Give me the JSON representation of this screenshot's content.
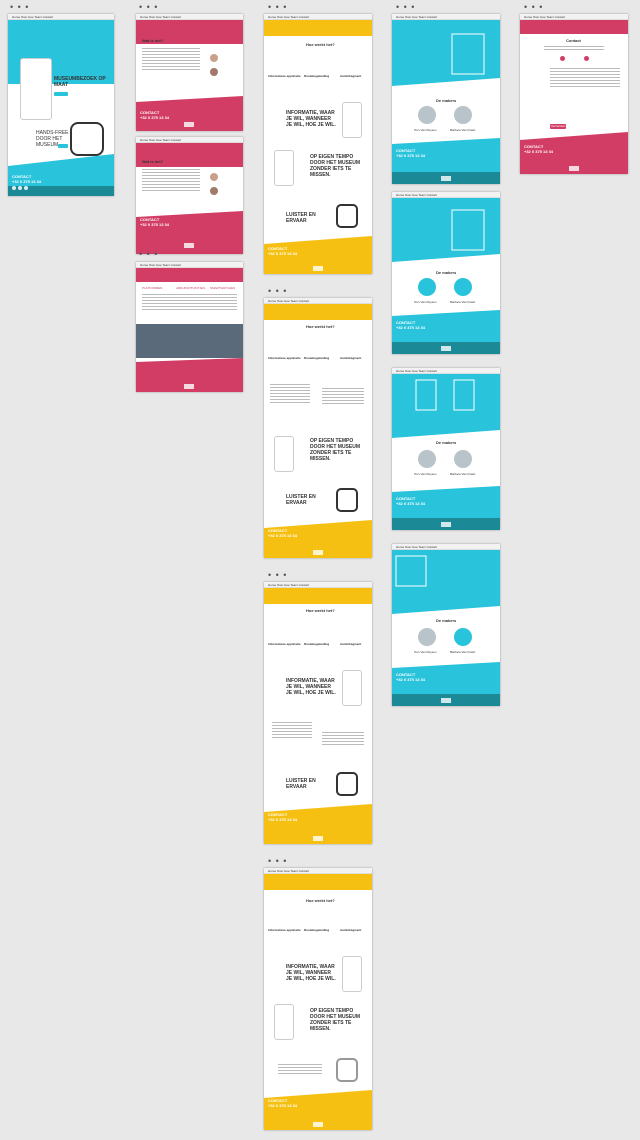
{
  "colors": {
    "cyan": "#29c4dc",
    "teal": "#1c8a96",
    "crimson": "#d23d66",
    "yellow": "#f6c012",
    "gray": "#e8e8e8"
  },
  "dots": "• • •",
  "nav": "Home  Over  Hoe  Team  Contact",
  "col1": {
    "hero_title": "MUSEUMBEZOEK OP MAAT",
    "hero_sub": "HANDS-FREE DOOR HET MUSEUM",
    "contact_label": "CONTACT",
    "contact_phone": "+32 0 375 13 34"
  },
  "col2": {
    "what_title": "Wat is het?",
    "contact_label": "CONTACT",
    "contact_phone": "+32 0 375 13 34",
    "table_headers": [
      "PLATFORMEN",
      "ARDUINO/TUINTJES",
      "SMARTWATCHES"
    ]
  },
  "col3": {
    "how_title": "Hoe werkt het?",
    "features": [
      "Informatieve applicatie",
      "Routebegeleiding",
      "Audiofragment"
    ],
    "headline_a": "INFORMATIE, WAAR JE WIL, WANNEER JE WIL, HOE JE WIL.",
    "headline_b": "OP EIGEN TEMPO DOOR HET MUSEUM ZONDER IETS TE MISSEN.",
    "headline_c": "LUISTER EN ERVAAR",
    "contact_label": "CONTACT",
    "contact_phone": "+32 0 375 13 34"
  },
  "col4": {
    "makers_title": "De makers",
    "makers": [
      "Tom Van Ruysen",
      "Barbara Van Fraeh"
    ],
    "contact_label": "CONTACT",
    "contact_phone": "+32 0 375 13 34"
  },
  "col5": {
    "contact_title": "Contact",
    "send_label": "Verzenden",
    "contact_label": "CONTACT",
    "contact_phone": "+32 0 375 13 34"
  }
}
